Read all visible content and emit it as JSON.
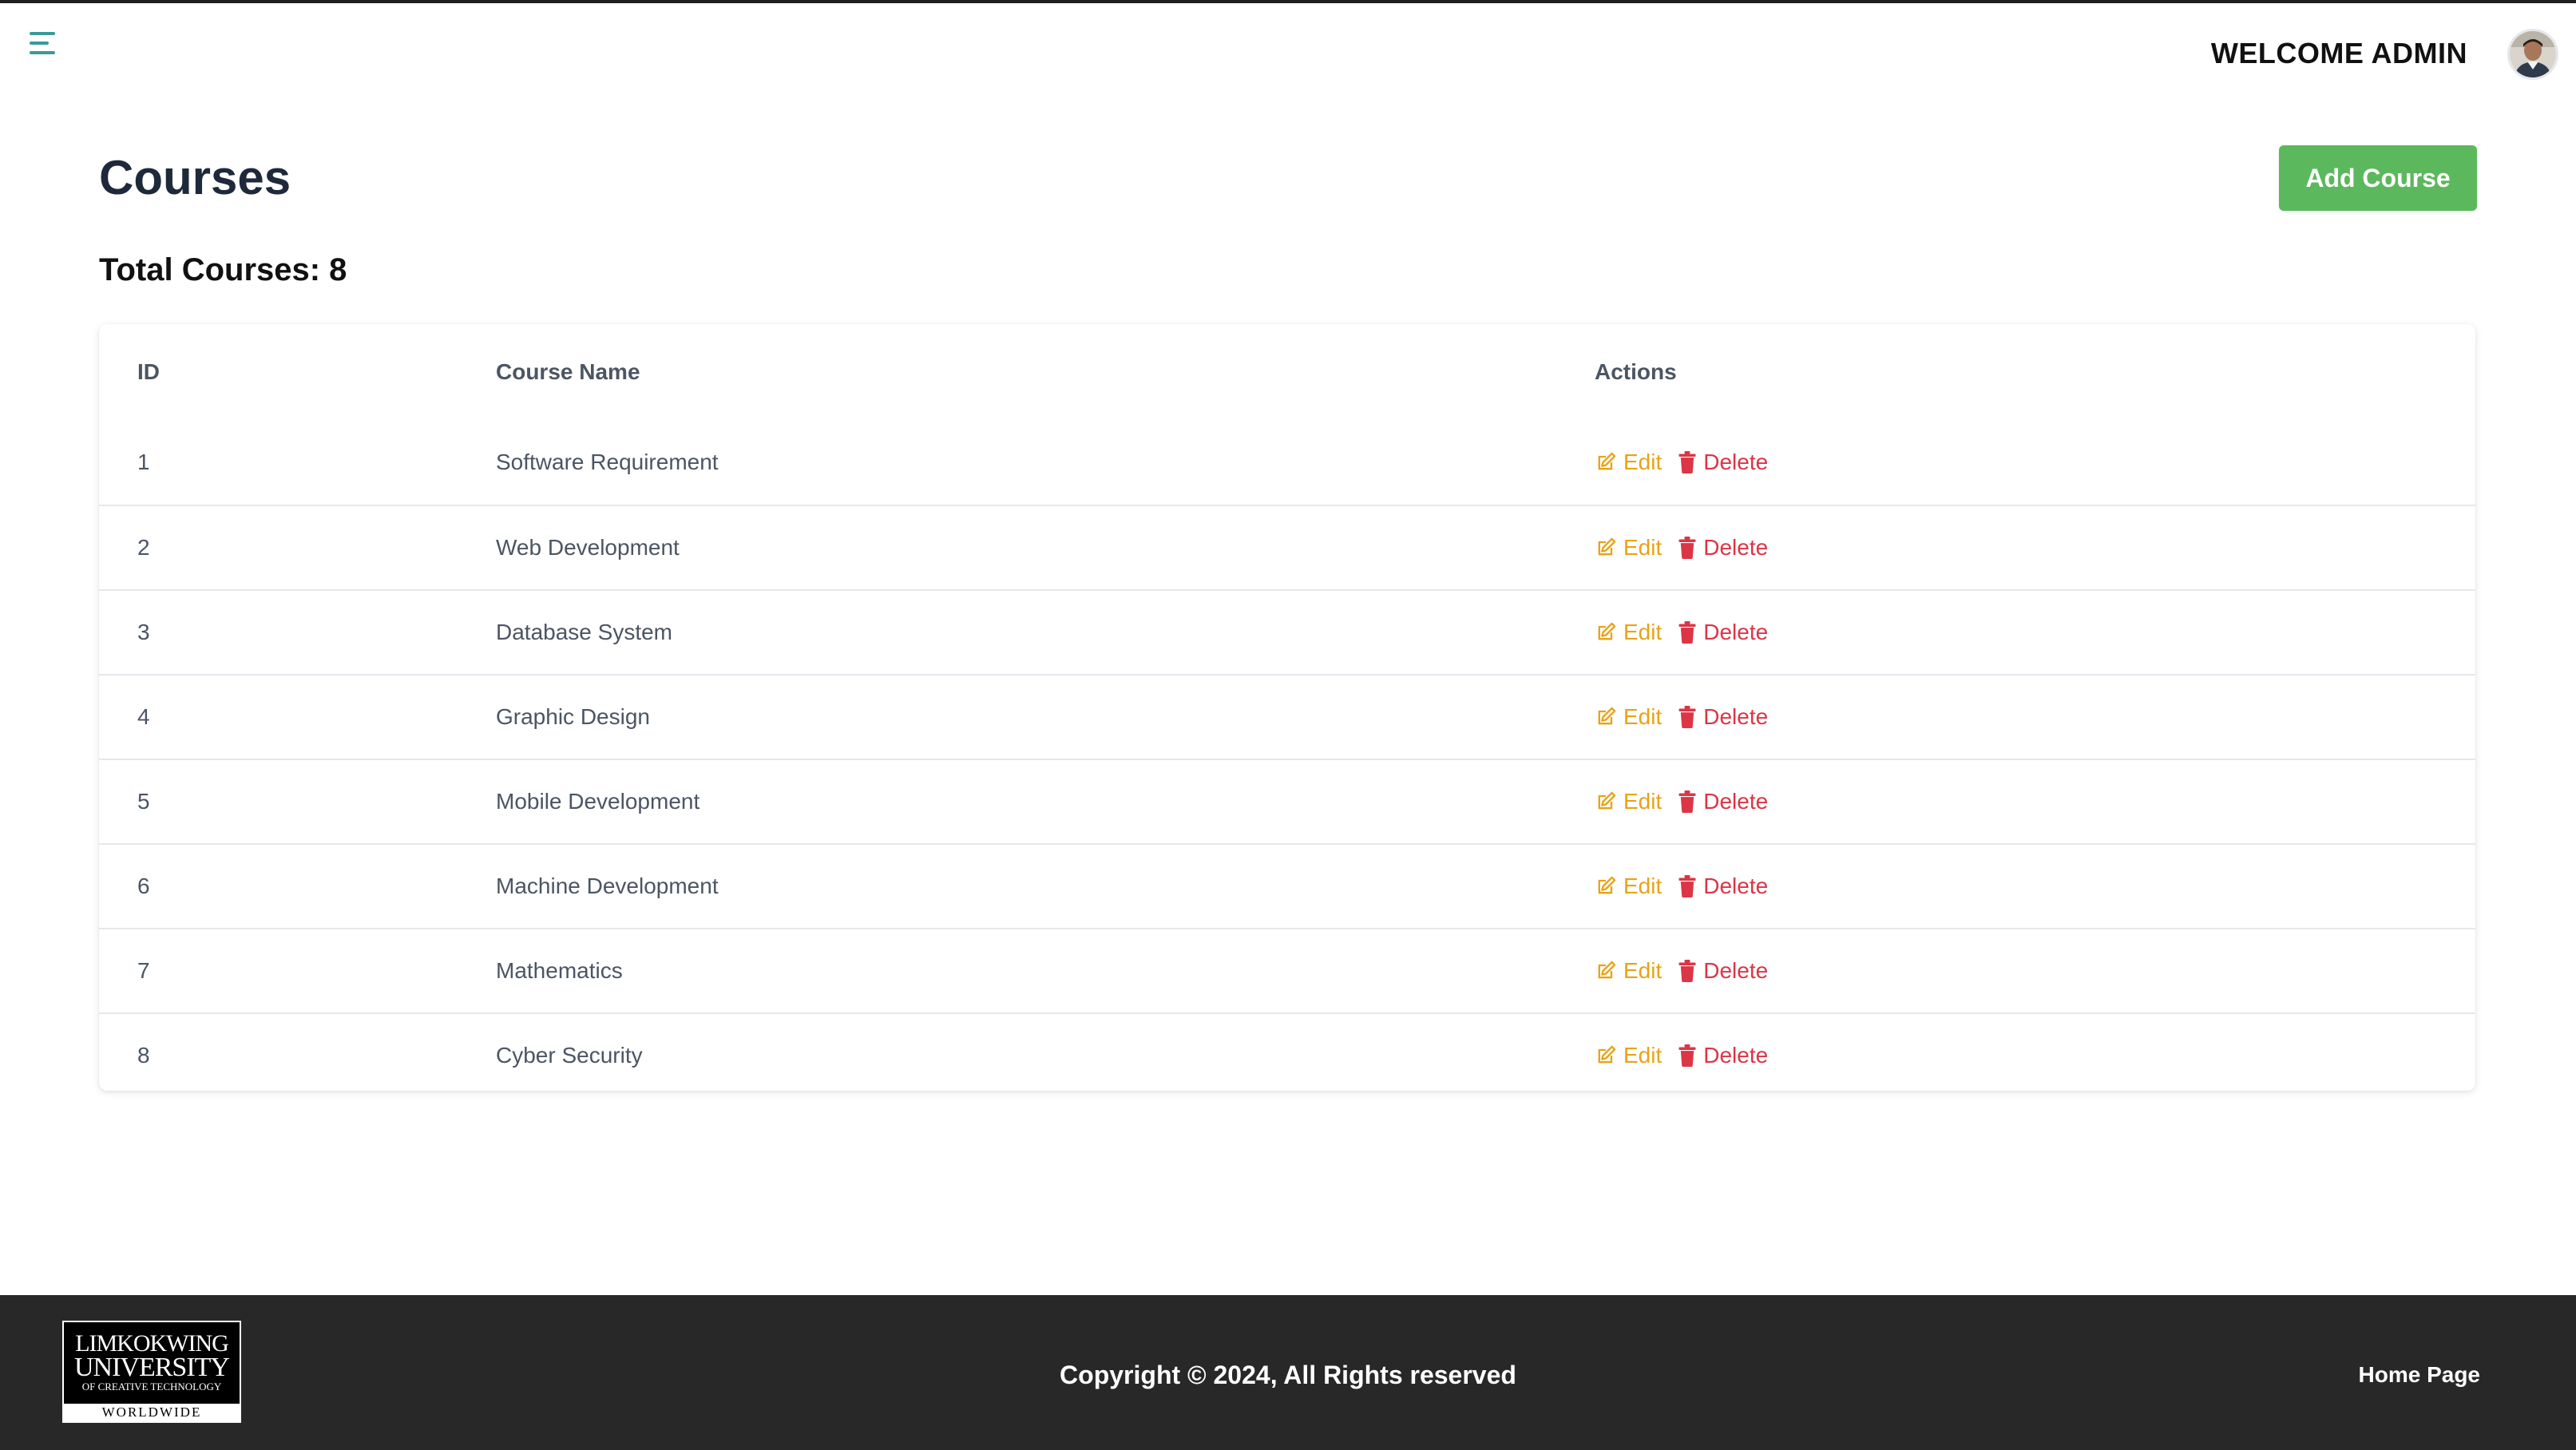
{
  "header": {
    "menu_icon": "hamburger-menu-icon",
    "welcome_text": "WELCOME ADMIN",
    "avatar_icon": "user-avatar"
  },
  "page": {
    "title": "Courses",
    "add_button_label": "Add Course",
    "total_label": "Total Courses: 8"
  },
  "table": {
    "columns": [
      "ID",
      "Course Name",
      "Actions"
    ],
    "rows": [
      {
        "id": "1",
        "name": "Software Requirement"
      },
      {
        "id": "2",
        "name": "Web Development"
      },
      {
        "id": "3",
        "name": "Database System"
      },
      {
        "id": "4",
        "name": "Graphic Design"
      },
      {
        "id": "5",
        "name": "Mobile Development"
      },
      {
        "id": "6",
        "name": "Machine Development"
      },
      {
        "id": "7",
        "name": "Mathematics"
      },
      {
        "id": "8",
        "name": "Cyber Security"
      }
    ],
    "edit_label": "Edit",
    "delete_label": "Delete"
  },
  "footer": {
    "logo": {
      "line1": "LIMKOKWING",
      "line2": "UNIVERSITY",
      "line3": "OF CREATIVE TECHNOLOGY",
      "line4": "WORLDWIDE"
    },
    "copyright": "Copyright © 2024, All Rights reserved",
    "home_link": "Home Page"
  },
  "colors": {
    "add_button": "#5cb85c",
    "edit": "#e8a317",
    "delete": "#dc3545",
    "footer_bg": "#282828",
    "menu_icon": "#3a9a9a"
  }
}
